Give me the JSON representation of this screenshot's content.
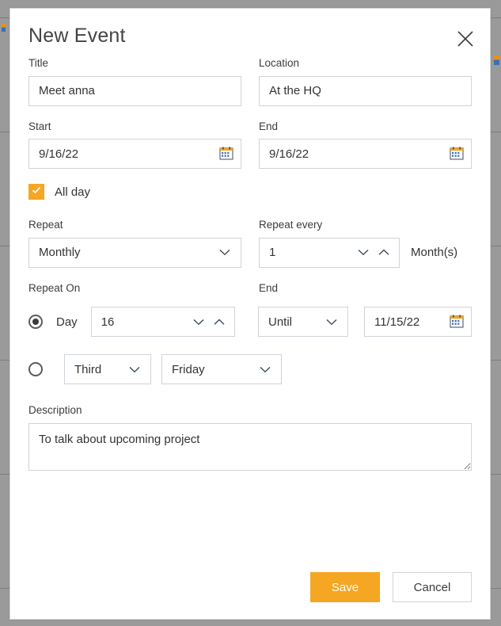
{
  "dialog": {
    "title": "New Event",
    "close_icon": "close-icon"
  },
  "fields": {
    "title": {
      "label": "Title",
      "value": "Meet anna",
      "placeholder": "Title"
    },
    "location": {
      "label": "Location",
      "value": "At the HQ",
      "placeholder": "Location"
    },
    "start": {
      "label": "Start",
      "value": "9/16/22",
      "placeholder": "M/d/yy",
      "icon": "calendar-icon"
    },
    "end": {
      "label": "End",
      "value": "9/16/22",
      "placeholder": "M/d/yy",
      "icon": "calendar-icon"
    },
    "all_day": {
      "label": "All day",
      "checked": true,
      "check_icon": "check-icon"
    },
    "repeat": {
      "label": "Repeat",
      "value": "Monthly",
      "chevron_icon": "chevron-down-icon"
    },
    "repeat_every": {
      "label": "Repeat every",
      "value": "1",
      "unit": "Month(s)",
      "down_icon": "chevron-down-icon",
      "up_icon": "chevron-up-icon"
    },
    "repeat_on": {
      "label": "Repeat On",
      "day_option_label": "Day",
      "day_value": "16",
      "day_down_icon": "chevron-down-icon",
      "day_up_icon": "chevron-up-icon",
      "day_selected": true,
      "ordinal_value": "Third",
      "weekday_value": "Friday",
      "ordinal_selected": false,
      "chevron_icon": "chevron-down-icon"
    },
    "recurrence_end": {
      "label": "End",
      "mode_value": "Until",
      "date_value": "11/15/22",
      "date_placeholder": "M/d/yy",
      "chevron_icon": "chevron-down-icon",
      "calendar_icon": "calendar-icon"
    },
    "description": {
      "label": "Description",
      "value": "To talk about upcoming project",
      "placeholder": "Description",
      "resize_handle_icon": "resize-handle-icon"
    }
  },
  "footer": {
    "save_label": "Save",
    "cancel_label": "Cancel"
  },
  "colors": {
    "accent": "#f5a623",
    "border": "#cfd4d9",
    "text": "#333333",
    "backdrop": "#9a9a9a"
  }
}
